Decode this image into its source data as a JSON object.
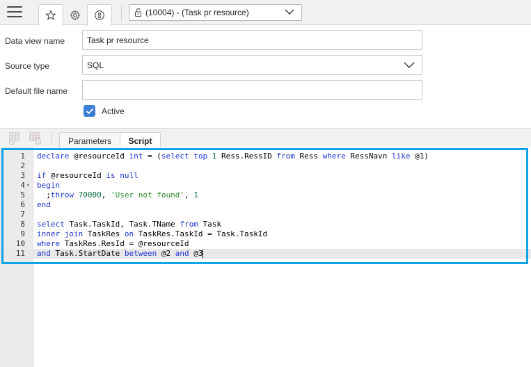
{
  "toolbar": {
    "data_view_select": "(10004) - (Task pr resource)"
  },
  "form": {
    "name_label": "Data view name",
    "name_value": "Task pr resource",
    "source_label": "Source type",
    "source_value": "SQL",
    "file_label": "Default file name",
    "file_value": "",
    "active_label": "Active",
    "active_checked": true
  },
  "tabs": [
    {
      "label": "Parameters",
      "active": false
    },
    {
      "label": "Script",
      "active": true
    }
  ],
  "editor": {
    "current_line": 11,
    "lines": [
      {
        "n": "1",
        "text": "declare @resourceId int = (select top 1 Ress.RessID from Ress where RessNavn like @1)"
      },
      {
        "n": "2",
        "text": ""
      },
      {
        "n": "3",
        "text": "if @resourceId is null"
      },
      {
        "n": "4",
        "text": "begin"
      },
      {
        "n": "5",
        "text": "  ;throw 70000, 'User not found', 1"
      },
      {
        "n": "6",
        "text": "end"
      },
      {
        "n": "7",
        "text": ""
      },
      {
        "n": "8",
        "text": "select Task.TaskId, Task.TName from Task"
      },
      {
        "n": "9",
        "text": "inner join TaskRes on TaskRes.TaskId = Task.TaskId"
      },
      {
        "n": "10",
        "text": "where TaskRes.ResId = @resourceId"
      },
      {
        "n": "11",
        "text": "and Task.StartDate between @2 and @3"
      }
    ]
  },
  "colors": {
    "highlight": "#0fa4e6",
    "checkbox": "#3b7fd4",
    "keyword": "#1d35d6"
  }
}
